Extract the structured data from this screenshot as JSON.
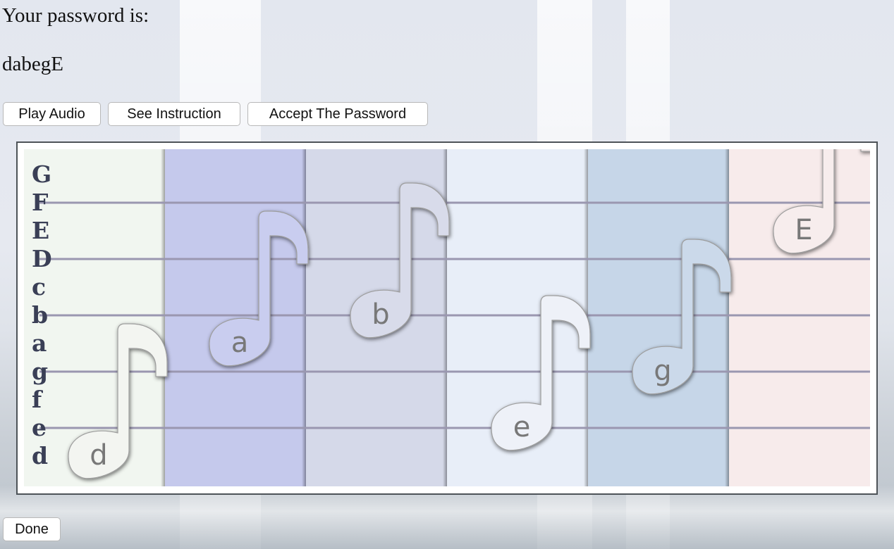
{
  "header": {
    "title": "Your password is:",
    "password": "dabegE"
  },
  "toolbar": {
    "play_audio_label": "Play Audio",
    "see_instruction_label": "See Instruction",
    "accept_label": "Accept The Password"
  },
  "footer": {
    "done_label": "Done"
  },
  "staff": {
    "pitch_labels": [
      "G",
      "F",
      "E",
      "D",
      "c",
      "b",
      "a",
      "g",
      "f",
      "e",
      "d"
    ],
    "line_color": "#9a97b0",
    "columns": [
      {
        "note": "d",
        "color": "#f1f6f0",
        "note_fill": "#f3f5f1"
      },
      {
        "note": "a",
        "color": "#c5c9ec",
        "note_fill": "#c9cdef"
      },
      {
        "note": "b",
        "color": "#d5d9e9",
        "note_fill": "#d8dbea"
      },
      {
        "note": "e",
        "color": "#e8eef8",
        "note_fill": "#eef1f8"
      },
      {
        "note": "g",
        "color": "#c6d6e8",
        "note_fill": "#cbd9ea"
      },
      {
        "note": "E",
        "color": "#f7ebeb",
        "note_fill": "#f7eded"
      }
    ],
    "note_label_color": "#787878"
  }
}
